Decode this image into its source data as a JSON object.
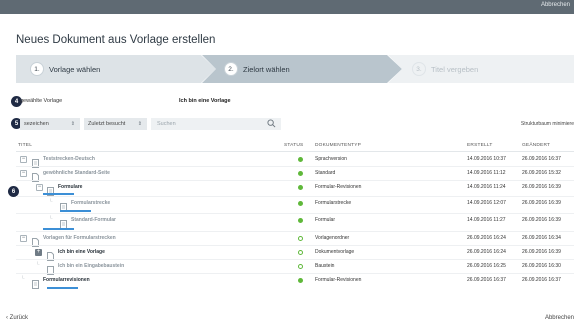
{
  "topbar": {
    "cancel_label": "Abbrechen"
  },
  "page_title": "Neues Dokument aus Vorlage erstellen",
  "wizard": {
    "steps": [
      {
        "number": "1.",
        "label": "Vorlage wählen"
      },
      {
        "number": "2.",
        "label": "Zielort wählen"
      },
      {
        "number": "3.",
        "label": "Titel vergeben"
      }
    ]
  },
  "markers": [
    "4",
    "5",
    "6"
  ],
  "template": {
    "label": "gewählte Vorlage",
    "value": "Ich bin eine Vorlage"
  },
  "filters": {
    "bookmarks": "sezeichen",
    "recent": "Zuletzt besucht",
    "search_placeholder": "Suchen",
    "tree_minimize": "Strukturbaum minimiere"
  },
  "table": {
    "headers": {
      "title": "TITEL",
      "status": "STATUS",
      "doctype": "DOKUMENTENTYP",
      "created": "ERSTELLT",
      "changed": "GEÄNDERT"
    },
    "rows": [
      {
        "title": "Teststrecken-Deutsch",
        "doctype": "Sprachversion",
        "created": "14.09.2016 10:37",
        "changed": "26.09.2016 16:37",
        "status": "full"
      },
      {
        "title": "gewöhnliche Standard-Seite",
        "doctype": "Standard",
        "created": "14.09.2016 11:12",
        "changed": "26.09.2016 15:32",
        "status": "full"
      },
      {
        "title": "Formulare",
        "doctype": "Formular-Revisionen",
        "created": "14.09.2016 11:24",
        "changed": "26.09.2016 16:39",
        "status": "full"
      },
      {
        "title": "Formularstrecke",
        "doctype": "Formularstrecke",
        "created": "14.09.2016 12:07",
        "changed": "26.09.2016 16:39",
        "status": "full"
      },
      {
        "title": "Standard-Formular",
        "doctype": "Formular",
        "created": "14.09.2016 11:27",
        "changed": "26.09.2016 16:39",
        "status": "full"
      },
      {
        "title": "Vorlagen für Formularstrecken",
        "doctype": "Vorlagenordner",
        "created": "26.09.2016 16:24",
        "changed": "26.09.2016 16:34",
        "status": "ring"
      },
      {
        "title": "Ich bin eine Vorlage",
        "doctype": "Dokumentvorlage",
        "created": "26.09.2016 16:24",
        "changed": "26.09.2016 16:39",
        "status": "ring"
      },
      {
        "title": "Ich bin ein Eingabebaustein",
        "doctype": "Baustein",
        "created": "26.09.2016 16:25",
        "changed": "26.09.2016 16:30",
        "status": "ring"
      },
      {
        "title": "Formularrevisionen",
        "doctype": "Formular-Revisionen",
        "created": "26.09.2016 16:37",
        "changed": "26.09.2016 16:37",
        "status": "full"
      }
    ]
  },
  "footer": {
    "back_label": "Zurück",
    "cancel_label": "Abbrechen"
  },
  "colors": {
    "topbar": "#5f6a73",
    "marker": "#1f2a44",
    "status_green": "#5fb83a",
    "link_blue": "#3c8fd6"
  }
}
